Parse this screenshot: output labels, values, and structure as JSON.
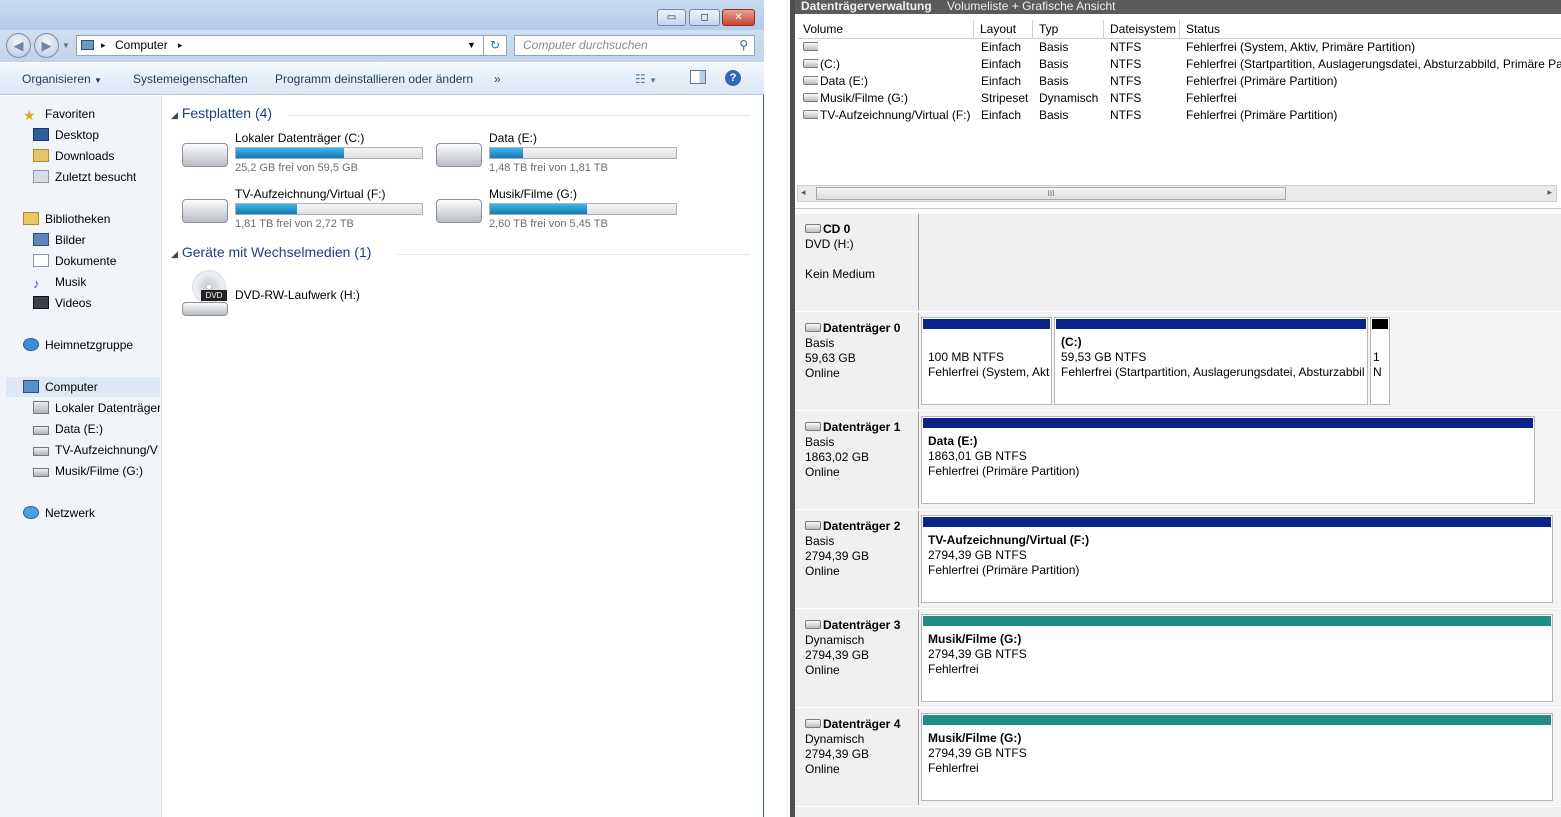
{
  "explorer": {
    "window_buttons": {
      "minimize": "▭",
      "maximize": "◻",
      "close": "✕"
    },
    "address": {
      "root": "Computer"
    },
    "search": {
      "placeholder": "Computer durchsuchen"
    },
    "toolbar": {
      "organize": "Organisieren",
      "system_properties": "Systemeigenschaften",
      "uninstall": "Programm deinstallieren oder ändern",
      "more": "»"
    },
    "nav": {
      "favorites": "Favoriten",
      "desktop": "Desktop",
      "downloads": "Downloads",
      "recent": "Zuletzt besucht",
      "libraries": "Bibliotheken",
      "pictures": "Bilder",
      "documents": "Dokumente",
      "music": "Musik",
      "videos": "Videos",
      "homegroup": "Heimnetzgruppe",
      "computer": "Computer",
      "drive_c": "Lokaler Datenträger",
      "drive_e": "Data (E:)",
      "drive_f": "TV-Aufzeichnung/V",
      "drive_g": "Musik/Filme (G:)",
      "network": "Netzwerk"
    },
    "groups": {
      "hard_disks": "Festplatten (4)",
      "removable": "Geräte mit Wechselmedien (1)"
    },
    "drives": [
      {
        "name": "Lokaler Datenträger (C:)",
        "free": "25,2 GB frei von 59,5 GB",
        "used_fraction": 0.58
      },
      {
        "name": "Data (E:)",
        "free": "1,48 TB frei von 1,81 TB",
        "used_fraction": 0.18
      },
      {
        "name": "TV-Aufzeichnung/Virtual (F:)",
        "free": "1,81 TB frei von 2,72 TB",
        "used_fraction": 0.33
      },
      {
        "name": "Musik/Filme (G:)",
        "free": "2,60 TB frei von 5,45 TB",
        "used_fraction": 0.52
      }
    ],
    "dvd": {
      "name": "DVD-RW-Laufwerk (H:)",
      "icon_text": "DVD"
    }
  },
  "diskmgmt": {
    "title": "Datenträgerverwaltung",
    "subtitle": "Volumeliste + Grafische Ansicht",
    "columns": [
      "Volume",
      "Layout",
      "Typ",
      "Dateisystem",
      "Status"
    ],
    "volumes": [
      {
        "volume": "",
        "layout": "Einfach",
        "typ": "Basis",
        "fs": "NTFS",
        "status": "Fehlerfrei (System, Aktiv, Primäre Partition)"
      },
      {
        "volume": "(C:)",
        "layout": "Einfach",
        "typ": "Basis",
        "fs": "NTFS",
        "status": "Fehlerfrei (Startpartition, Auslagerungsdatei, Absturzabbild, Primäre Part"
      },
      {
        "volume": "Data (E:)",
        "layout": "Einfach",
        "typ": "Basis",
        "fs": "NTFS",
        "status": "Fehlerfrei (Primäre Partition)"
      },
      {
        "volume": "Musik/Filme (G:)",
        "layout": "Stripeset",
        "typ": "Dynamisch",
        "fs": "NTFS",
        "status": "Fehlerfrei"
      },
      {
        "volume": "TV-Aufzeichnung/Virtual (F:)",
        "layout": "Einfach",
        "typ": "Basis",
        "fs": "NTFS",
        "status": "Fehlerfrei (Primäre Partition)"
      }
    ],
    "scroll": {
      "left": "◂",
      "right": "▸",
      "thumb": "III"
    },
    "disks": [
      {
        "name": "CD 0",
        "l1": "DVD (H:)",
        "l2": "",
        "l3": "Kein Medium"
      },
      {
        "name": "Datenträger 0",
        "l1": "Basis",
        "l2": "59,63 GB",
        "l3": "Online"
      },
      {
        "name": "Datenträger 1",
        "l1": "Basis",
        "l2": "1863,02 GB",
        "l3": "Online"
      },
      {
        "name": "Datenträger 2",
        "l1": "Basis",
        "l2": "2794,39 GB",
        "l3": "Online"
      },
      {
        "name": "Datenträger 3",
        "l1": "Dynamisch",
        "l2": "2794,39 GB",
        "l3": "Online"
      },
      {
        "name": "Datenträger 4",
        "l1": "Dynamisch",
        "l2": "2794,39 GB",
        "l3": "Online"
      }
    ],
    "partitions": {
      "d0p1": {
        "title": "",
        "size": "100 MB NTFS",
        "status": "Fehlerfrei (System, Akt"
      },
      "d0p2": {
        "title": "(C:)",
        "size": "59,53 GB NTFS",
        "status": "Fehlerfrei (Startpartition, Auslagerungsdatei, Absturzabbil"
      },
      "d0p3": {
        "size": "1",
        "status": "N"
      },
      "d1p1": {
        "title": "Data  (E:)",
        "size": "1863,01 GB NTFS",
        "status": "Fehlerfrei (Primäre Partition)"
      },
      "d2p1": {
        "title": "TV-Aufzeichnung/Virtual  (F:)",
        "size": "2794,39 GB NTFS",
        "status": "Fehlerfrei (Primäre Partition)"
      },
      "d3p1": {
        "title": "Musik/Filme  (G:)",
        "size": "2794,39 GB NTFS",
        "status": "Fehlerfrei"
      },
      "d4p1": {
        "title": "Musik/Filme  (G:)",
        "size": "2794,39 GB NTFS",
        "status": "Fehlerfrei"
      }
    },
    "colors": {
      "primary_partition": "#0a248a",
      "dynamic_volume": "#1f8d83",
      "unallocated": "#000000"
    }
  }
}
